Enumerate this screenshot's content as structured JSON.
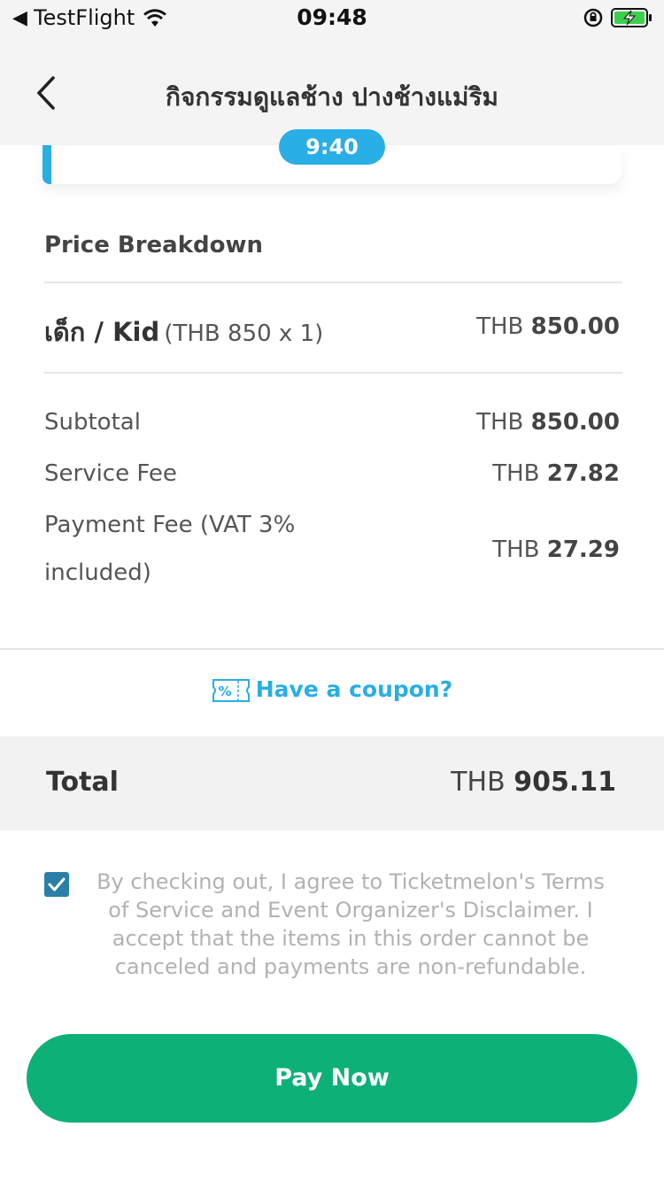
{
  "status_bar": {
    "back_arrow": "◀",
    "app_name": "TestFlight",
    "time": "09:48",
    "icons": [
      "wifi-icon",
      "rotation-lock-icon",
      "battery-charging-icon"
    ]
  },
  "header": {
    "title": "กิจกรรมดูแลช้าง ปางช้างแม่ริม",
    "timer": "9:40"
  },
  "price_breakdown": {
    "title": "Price Breakdown",
    "item": {
      "name": "เด็ก / Kid",
      "detail": "(THB 850 x 1)",
      "currency": "THB",
      "amount": "850.00"
    },
    "lines": [
      {
        "label": "Subtotal",
        "currency": "THB",
        "amount": "850.00"
      },
      {
        "label": "Service Fee",
        "currency": "THB",
        "amount": "27.82"
      },
      {
        "label_line1": "Payment Fee (VAT 3%",
        "label_line2": "included)",
        "currency": "THB",
        "amount": "27.29"
      }
    ]
  },
  "coupon": {
    "label": "Have a coupon?",
    "icon": "coupon-icon"
  },
  "total": {
    "label": "Total",
    "currency": "THB",
    "amount": "905.11"
  },
  "agreement": {
    "checked": true,
    "line1": "By checking out, I agree to Ticketmelon's Terms",
    "line2": "of Service and Event Organizer's Disclaimer. I",
    "line3": "accept that the items in this order cannot be",
    "line4": "canceled and payments are non-refundable."
  },
  "pay_button": {
    "label": "Pay Now"
  },
  "colors": {
    "accent_blue": "#29aee6",
    "pay_green": "#0db077",
    "checkbox_blue": "#2a7fa6",
    "battery_green": "#3ccf4e"
  }
}
